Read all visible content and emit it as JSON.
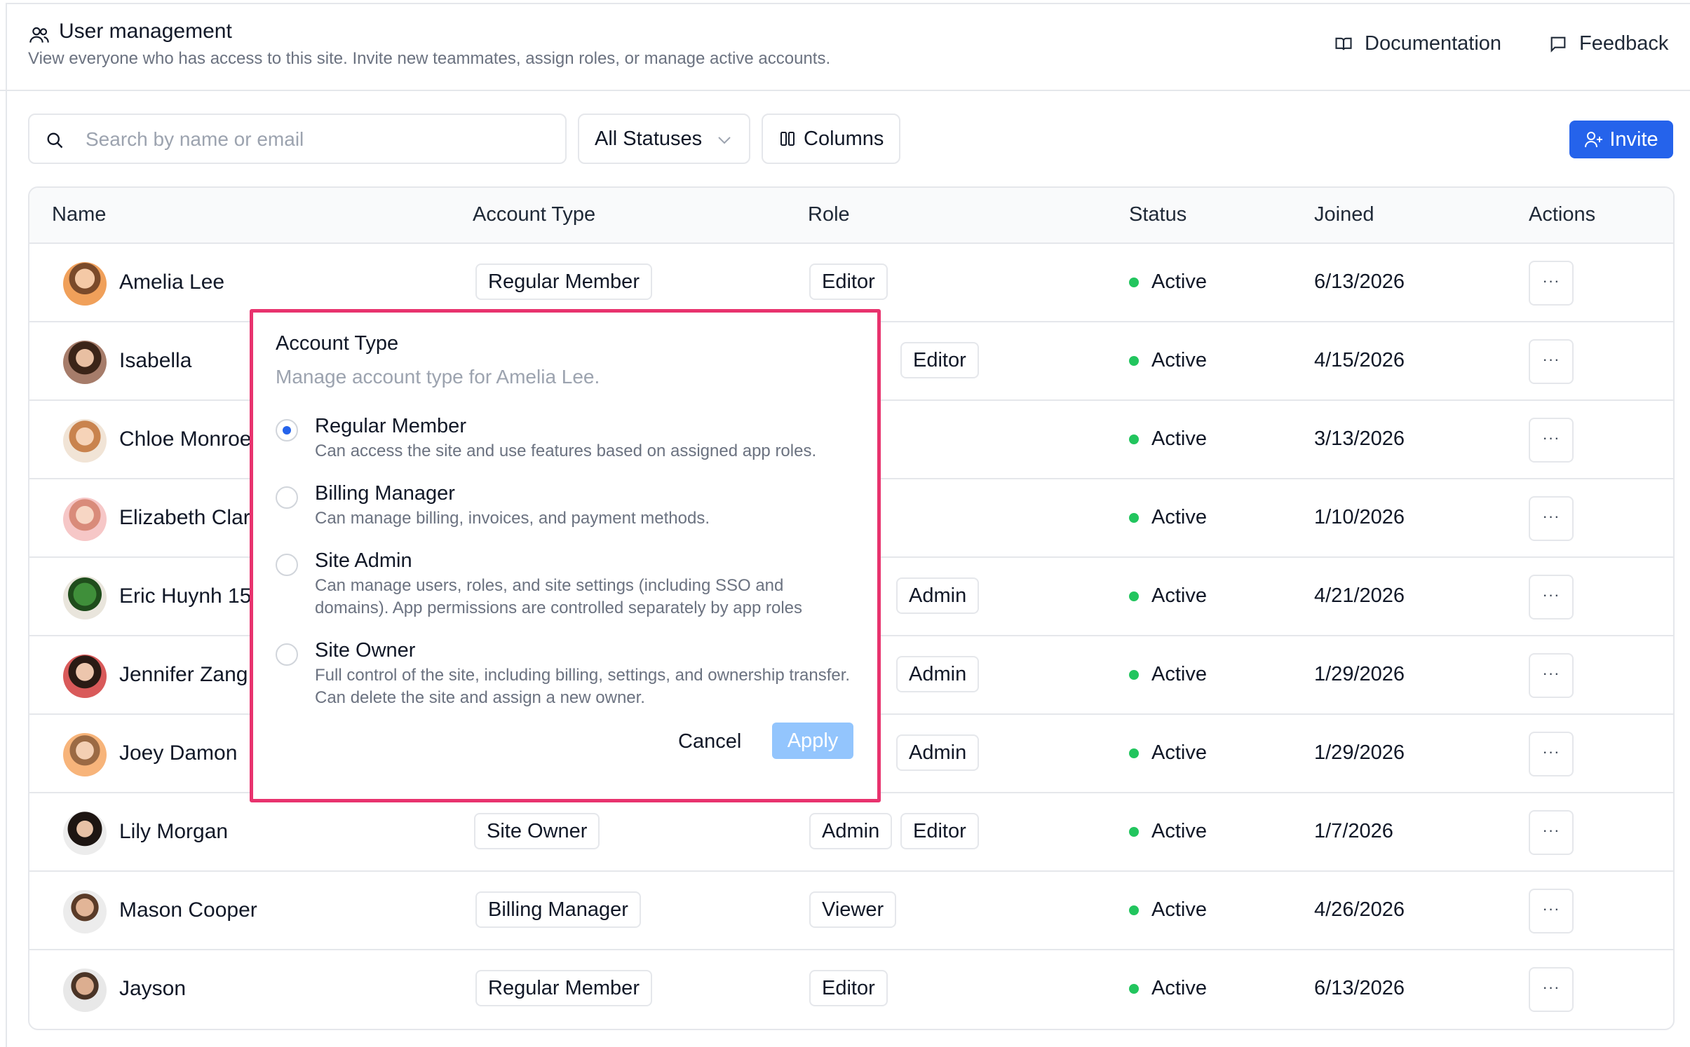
{
  "header": {
    "title": "User management",
    "subtitle": "View everyone who has access to this site. Invite new teammates, assign roles, or manage active accounts.",
    "documentation_label": "Documentation",
    "feedback_label": "Feedback"
  },
  "toolbar": {
    "search_placeholder": "Search by name or email",
    "status_filter": "All Statuses",
    "columns_label": "Columns",
    "invite_label": "Invite"
  },
  "table": {
    "columns": [
      "Name",
      "Account Type",
      "Role",
      "Status",
      "Joined",
      "Actions"
    ],
    "rows": [
      {
        "name": "Amelia Lee",
        "account_type": "Regular Member",
        "roles": [
          "Editor"
        ],
        "status": "Active",
        "joined": "6/13/2026",
        "actions": "···"
      },
      {
        "name": "Isabella",
        "account_type": "",
        "roles": [
          "Editor"
        ],
        "status": "Active",
        "joined": "4/15/2026",
        "actions": "···"
      },
      {
        "name": "Chloe Monroe",
        "account_type": "",
        "roles": [],
        "status": "Active",
        "joined": "3/13/2026",
        "actions": "···"
      },
      {
        "name": "Elizabeth Clar",
        "account_type": "",
        "roles": [],
        "status": "Active",
        "joined": "1/10/2026",
        "actions": "···"
      },
      {
        "name": "Eric Huynh 15",
        "account_type": "",
        "roles": [
          "Admin"
        ],
        "status": "Active",
        "joined": "4/21/2026",
        "actions": "···"
      },
      {
        "name": "Jennifer Zang",
        "account_type": "",
        "roles": [
          "Admin"
        ],
        "status": "Active",
        "joined": "1/29/2026",
        "actions": "···"
      },
      {
        "name": "Joey Damon",
        "account_type": "",
        "roles": [
          "Admin"
        ],
        "status": "Active",
        "joined": "1/29/2026",
        "actions": "···"
      },
      {
        "name": "Lily Morgan",
        "account_type": "Site Owner",
        "roles": [
          "Admin",
          "Editor"
        ],
        "status": "Active",
        "joined": "1/7/2026",
        "actions": "···"
      },
      {
        "name": "Mason Cooper",
        "account_type": "Billing Manager",
        "roles": [
          "Viewer"
        ],
        "status": "Active",
        "joined": "4/26/2026",
        "actions": "···"
      },
      {
        "name": "Jayson",
        "account_type": "Regular Member",
        "roles": [
          "Editor"
        ],
        "status": "Active",
        "joined": "6/13/2026",
        "actions": "···"
      }
    ]
  },
  "popover": {
    "title": "Account Type",
    "subtitle": "Manage account type for Amelia Lee.",
    "options": [
      {
        "label": "Regular Member",
        "description": "Can access the site and use features based on assigned app roles.",
        "selected": true
      },
      {
        "label": "Billing Manager",
        "description": "Can manage billing, invoices, and payment methods.",
        "selected": false
      },
      {
        "label": "Site Admin",
        "description": "Can manage users, roles, and site settings (including SSO and domains). App permissions are controlled separately by app roles",
        "selected": false
      },
      {
        "label": "Site Owner",
        "description": "Full control of the site, including billing, settings, and ownership transfer. Can delete the site and assign a new owner.",
        "selected": false
      }
    ],
    "cancel_label": "Cancel",
    "apply_label": "Apply"
  },
  "colors": {
    "accent": "#2563eb",
    "apply_disabled": "#93c5fd",
    "status_active": "#22c55e",
    "highlight_border": "#e8336e"
  }
}
